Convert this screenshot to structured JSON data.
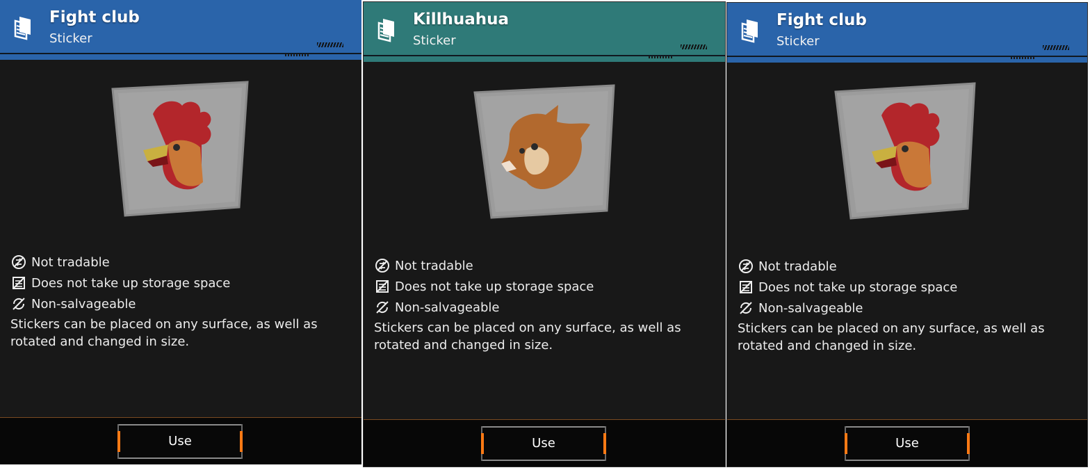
{
  "cards": [
    {
      "title": "Fight club",
      "subtitle": "Sticker",
      "art": "rooster-sticker-icon",
      "header_color": "#2a64aa",
      "props": [
        {
          "icon": "not-tradable-icon",
          "label": "Not tradable"
        },
        {
          "icon": "no-storage-icon",
          "label": "Does not take up storage space"
        },
        {
          "icon": "non-salvageable-icon",
          "label": "Non-salvageable"
        }
      ],
      "description": "Stickers can be placed on any surface, as well as rotated and changed in size.",
      "button_label": "Use"
    },
    {
      "title": "Killhuahua",
      "subtitle": "Sticker",
      "art": "chihuahua-sticker-icon",
      "header_color": "#2f7a78",
      "props": [
        {
          "icon": "not-tradable-icon",
          "label": "Not tradable"
        },
        {
          "icon": "no-storage-icon",
          "label": "Does not take up storage space"
        },
        {
          "icon": "non-salvageable-icon",
          "label": "Non-salvageable"
        }
      ],
      "description": "Stickers can be placed on any surface, as well as rotated and changed in size.",
      "button_label": "Use"
    },
    {
      "title": "Fight club",
      "subtitle": "Sticker",
      "art": "rooster-sticker-icon",
      "header_color": "#2a64aa",
      "props": [
        {
          "icon": "not-tradable-icon",
          "label": "Not tradable"
        },
        {
          "icon": "no-storage-icon",
          "label": "Does not take up storage space"
        },
        {
          "icon": "non-salvageable-icon",
          "label": "Non-salvageable"
        }
      ],
      "description": "Stickers can be placed on any surface, as well as rotated and changed in size.",
      "button_label": "Use"
    }
  ],
  "colors": {
    "panel_bg": "#181818",
    "footer_bg": "#070707",
    "button_accent": "#ff7a14",
    "footer_rule": "#7a4a22"
  }
}
